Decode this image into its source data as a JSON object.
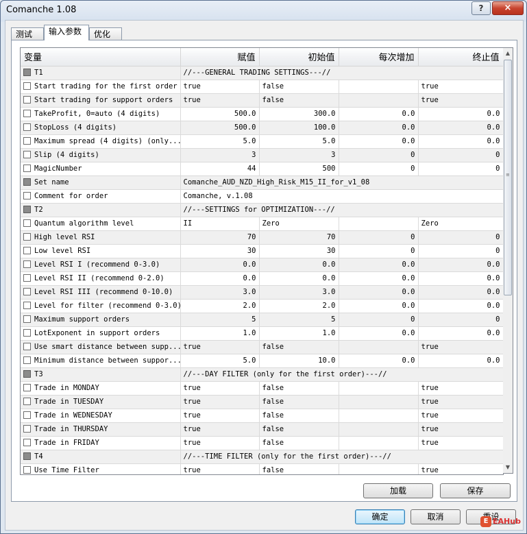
{
  "window": {
    "title": "Comanche 1.08",
    "help_label": "?",
    "close_label": "×"
  },
  "tabs": [
    {
      "label": "测试",
      "active": false
    },
    {
      "label": "输入参数",
      "active": true
    },
    {
      "label": "优化",
      "active": false
    }
  ],
  "grid": {
    "columns": [
      "变量",
      "赋值",
      "初始值",
      "每次增加",
      "终止值"
    ],
    "rows": [
      {
        "g": true,
        "cb": "gray",
        "name": "T1",
        "span": "//---GENERAL TRADING SETTINGS---//"
      },
      {
        "g": false,
        "cb": "white",
        "name": "Start trading for the first order",
        "v": "true",
        "s": "false",
        "st": "",
        "e": "true",
        "al": "l"
      },
      {
        "g": true,
        "cb": "white",
        "name": "Start trading for support orders",
        "v": "true",
        "s": "false",
        "st": "",
        "e": "true",
        "al": "l"
      },
      {
        "g": false,
        "cb": "white",
        "name": "TakeProfit, 0=auto (4 digits)",
        "v": "500.0",
        "s": "300.0",
        "st": "0.0",
        "e": "0.0",
        "al": "r"
      },
      {
        "g": true,
        "cb": "white",
        "name": "StopLoss (4 digits)",
        "v": "500.0",
        "s": "100.0",
        "st": "0.0",
        "e": "0.0",
        "al": "r"
      },
      {
        "g": false,
        "cb": "white",
        "name": "Maximum spread (4 digits) (only...",
        "v": "5.0",
        "s": "5.0",
        "st": "0.0",
        "e": "0.0",
        "al": "r"
      },
      {
        "g": true,
        "cb": "white",
        "name": "Slip (4 digits)",
        "v": "3",
        "s": "3",
        "st": "0",
        "e": "0",
        "al": "r"
      },
      {
        "g": false,
        "cb": "white",
        "name": "MagicNumber",
        "v": "44",
        "s": "500",
        "st": "0",
        "e": "0",
        "al": "r"
      },
      {
        "g": true,
        "cb": "gray",
        "name": "Set name",
        "span": "Comanche_AUD_NZD_High_Risk_M15_II_for_v1_08"
      },
      {
        "g": false,
        "cb": "white",
        "name": "Comment for order",
        "span": "Comanche, v.1.08"
      },
      {
        "g": true,
        "cb": "gray",
        "name": "T2",
        "span": "//---SETTINGS for OPTIMIZATION---//"
      },
      {
        "g": false,
        "cb": "white",
        "name": "Quantum algorithm level",
        "v": "II",
        "s": "Zero",
        "st": "",
        "e": "Zero",
        "al": "l"
      },
      {
        "g": true,
        "cb": "white",
        "name": "High level RSI",
        "v": "70",
        "s": "70",
        "st": "0",
        "e": "0",
        "al": "r"
      },
      {
        "g": false,
        "cb": "white",
        "name": "Low level RSI",
        "v": "30",
        "s": "30",
        "st": "0",
        "e": "0",
        "al": "r"
      },
      {
        "g": true,
        "cb": "white",
        "name": "Level RSI I (recommend 0-3.0)",
        "v": "0.0",
        "s": "0.0",
        "st": "0.0",
        "e": "0.0",
        "al": "r"
      },
      {
        "g": false,
        "cb": "white",
        "name": "Level RSI II (recommend 0-2.0)",
        "v": "0.0",
        "s": "0.0",
        "st": "0.0",
        "e": "0.0",
        "al": "r"
      },
      {
        "g": true,
        "cb": "white",
        "name": "Level RSI III (recommend 0-10.0)",
        "v": "3.0",
        "s": "3.0",
        "st": "0.0",
        "e": "0.0",
        "al": "r"
      },
      {
        "g": false,
        "cb": "white",
        "name": "Level for filter (recommend 0-3.0)",
        "v": "2.0",
        "s": "2.0",
        "st": "0.0",
        "e": "0.0",
        "al": "r"
      },
      {
        "g": true,
        "cb": "white",
        "name": "Maximum support orders",
        "v": "5",
        "s": "5",
        "st": "0",
        "e": "0",
        "al": "r"
      },
      {
        "g": false,
        "cb": "white",
        "name": "LotExponent in support orders",
        "v": "1.0",
        "s": "1.0",
        "st": "0.0",
        "e": "0.0",
        "al": "r"
      },
      {
        "g": true,
        "cb": "white",
        "name": "Use smart distance between supp...",
        "v": "true",
        "s": "false",
        "st": "",
        "e": "true",
        "al": "l"
      },
      {
        "g": false,
        "cb": "white",
        "name": "Minimum distance between suppor...",
        "v": "5.0",
        "s": "10.0",
        "st": "0.0",
        "e": "0.0",
        "al": "r"
      },
      {
        "g": true,
        "cb": "gray",
        "name": "T3",
        "span": "//---DAY FILTER (only for the first order)---//"
      },
      {
        "g": false,
        "cb": "white",
        "name": "Trade in MONDAY",
        "v": "true",
        "s": "false",
        "st": "",
        "e": "true",
        "al": "l"
      },
      {
        "g": true,
        "cb": "white",
        "name": "Trade in TUESDAY",
        "v": "true",
        "s": "false",
        "st": "",
        "e": "true",
        "al": "l"
      },
      {
        "g": false,
        "cb": "white",
        "name": "Trade in WEDNESDAY",
        "v": "true",
        "s": "false",
        "st": "",
        "e": "true",
        "al": "l"
      },
      {
        "g": true,
        "cb": "white",
        "name": "Trade in THURSDAY",
        "v": "true",
        "s": "false",
        "st": "",
        "e": "true",
        "al": "l"
      },
      {
        "g": false,
        "cb": "white",
        "name": "Trade in FRIDAY",
        "v": "true",
        "s": "false",
        "st": "",
        "e": "true",
        "al": "l"
      },
      {
        "g": true,
        "cb": "gray",
        "name": "T4",
        "span": "//---TIME FILTER (only for the first order)---//"
      },
      {
        "g": false,
        "cb": "white",
        "name": "Use Time Filter",
        "v": "true",
        "s": "false",
        "st": "",
        "e": "true",
        "al": "l"
      }
    ]
  },
  "panel_buttons": {
    "load": "加载",
    "save": "保存"
  },
  "dialog_buttons": {
    "ok": "确定",
    "cancel": "取消",
    "reset": "重设"
  },
  "watermark": {
    "icon": "E",
    "text": "EAHub"
  }
}
